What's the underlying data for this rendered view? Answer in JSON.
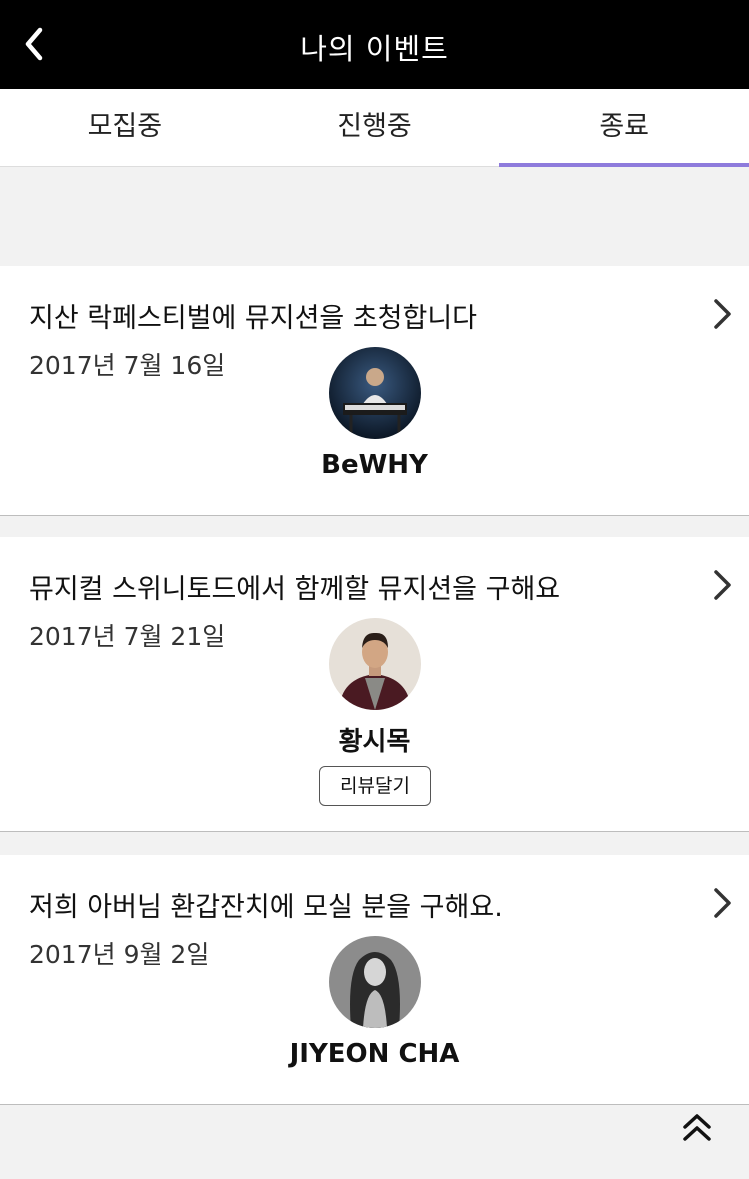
{
  "header": {
    "title": "나의 이벤트",
    "back_icon": "chevron-left-icon"
  },
  "tabs": [
    {
      "label": "모집중",
      "active": false
    },
    {
      "label": "진행중",
      "active": false
    },
    {
      "label": "종료",
      "active": true
    }
  ],
  "events": [
    {
      "title": "지산 락페스티벌에 뮤지션을 초청합니다",
      "date": "2017년 7월 16일",
      "artist": "BeWHY",
      "avatar_icon": "artist-photo-keyboard-player"
    },
    {
      "title": "뮤지컬 스위니토드에서 함께할 뮤지션을 구해요",
      "date": "2017년 7월 21일",
      "artist": "황시목",
      "review_label": "리뷰달기",
      "avatar_icon": "artist-photo-man-jacket"
    },
    {
      "title": "저희 아버님 환갑잔치에 모실 분을 구해요.",
      "date": "2017년 9월 2일",
      "artist": "JIYEON CHA",
      "avatar_icon": "artist-photo-woman-bw"
    }
  ],
  "scroll_top_icon": "double-chevron-up-icon",
  "colors": {
    "header_bg": "#000000",
    "tab_active_underline": "#8e7bdc",
    "page_bg": "#f2f2f2"
  }
}
